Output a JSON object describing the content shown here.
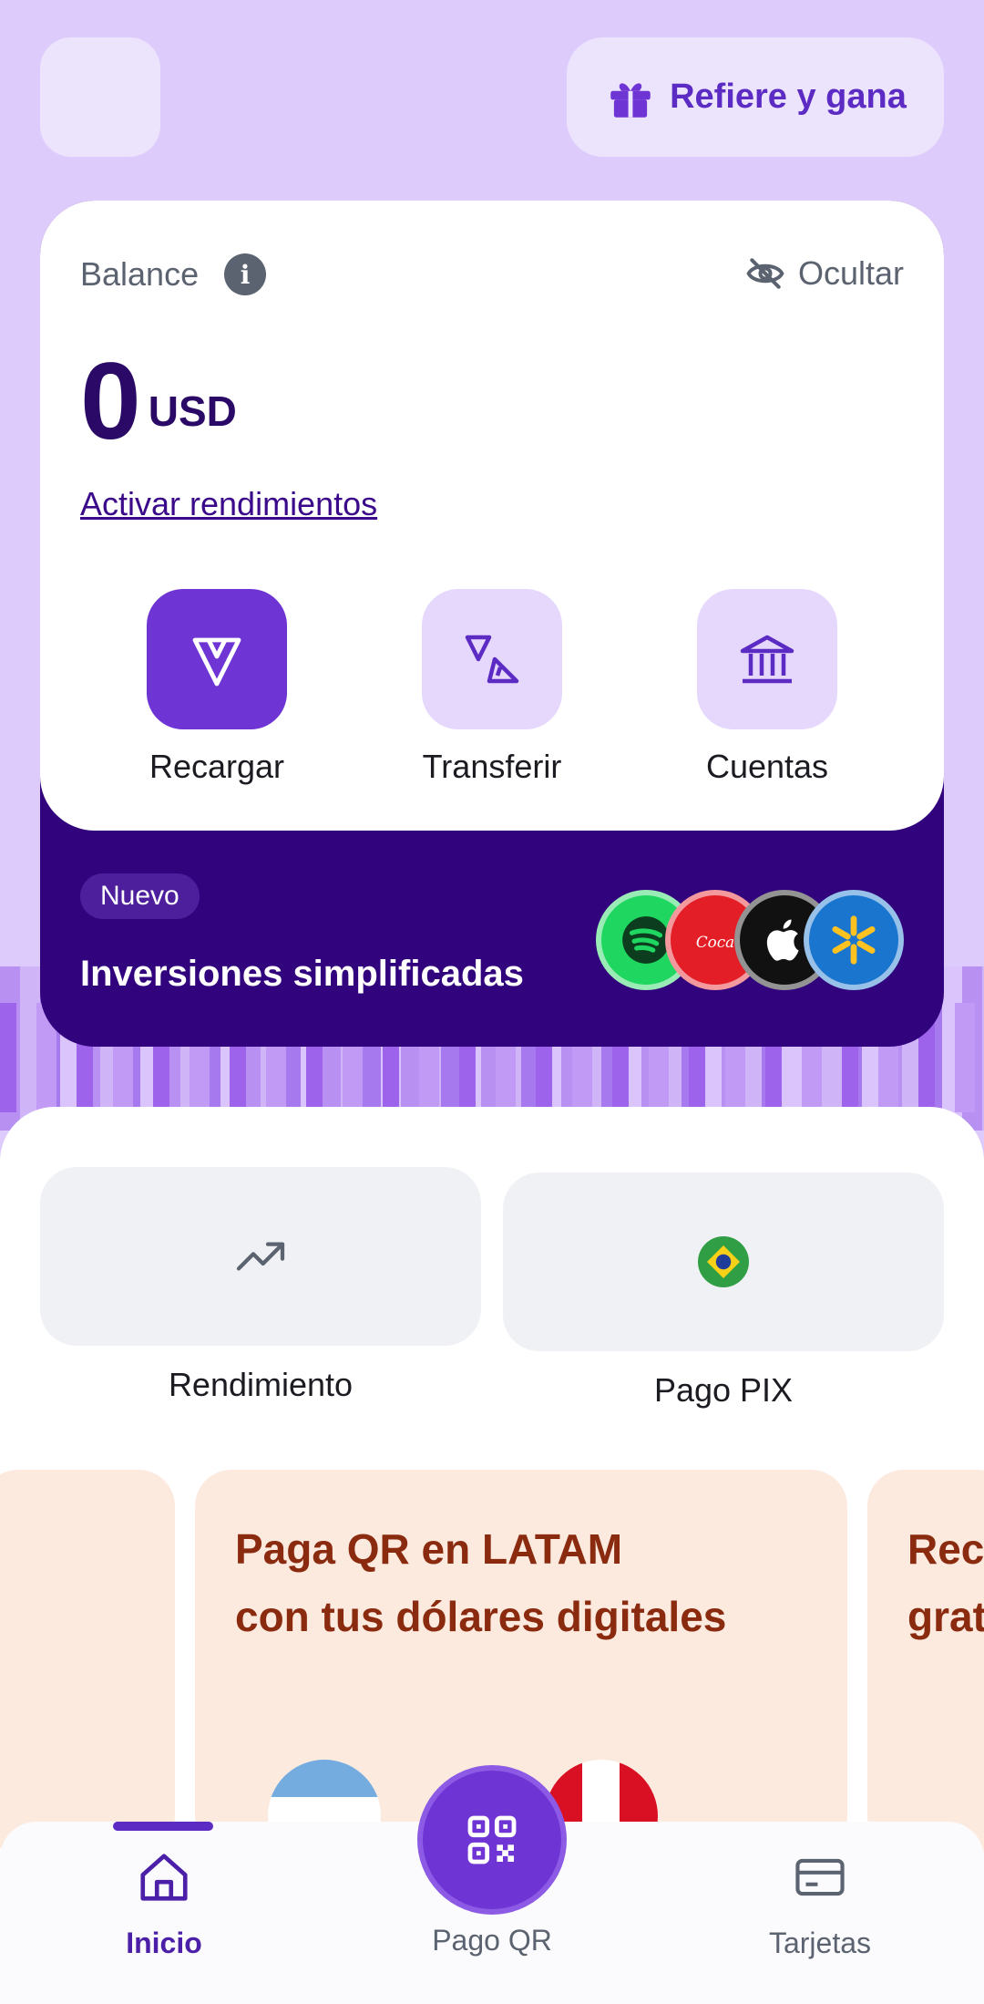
{
  "header": {
    "refer_label": "Refiere y gana"
  },
  "balance": {
    "label": "Balance",
    "hide_label": "Ocultar",
    "amount": "0",
    "currency": "USD",
    "activate_link": "Activar rendimientos",
    "actions": [
      {
        "label": "Recargar",
        "icon": "send-icon"
      },
      {
        "label": "Transferir",
        "icon": "transfer-icon"
      },
      {
        "label": "Cuentas",
        "icon": "bank-icon"
      }
    ]
  },
  "investments": {
    "badge": "Nuevo",
    "title": "Inversiones simplificadas",
    "logos": [
      "spotify-logo",
      "coca-cola-logo",
      "apple-logo",
      "walmart-logo"
    ]
  },
  "shortcuts": [
    {
      "label": "Rendimiento",
      "icon": "trending-up-icon"
    },
    {
      "label": "Pago PIX",
      "icon": "brazil-flag-icon"
    }
  ],
  "promos": [
    {
      "line1": "Paga QR en LATAM",
      "line2": "con tus dólares digitales"
    },
    {
      "line1": "Rec",
      "line2": "grat"
    }
  ],
  "nav": {
    "home": "Inicio",
    "qr": "Pago QR",
    "cards": "Tarjetas"
  },
  "colors": {
    "brand": "#6e34d4",
    "dark": "#31047d",
    "background": "#ddccfb",
    "promo": "#fdeadf"
  }
}
